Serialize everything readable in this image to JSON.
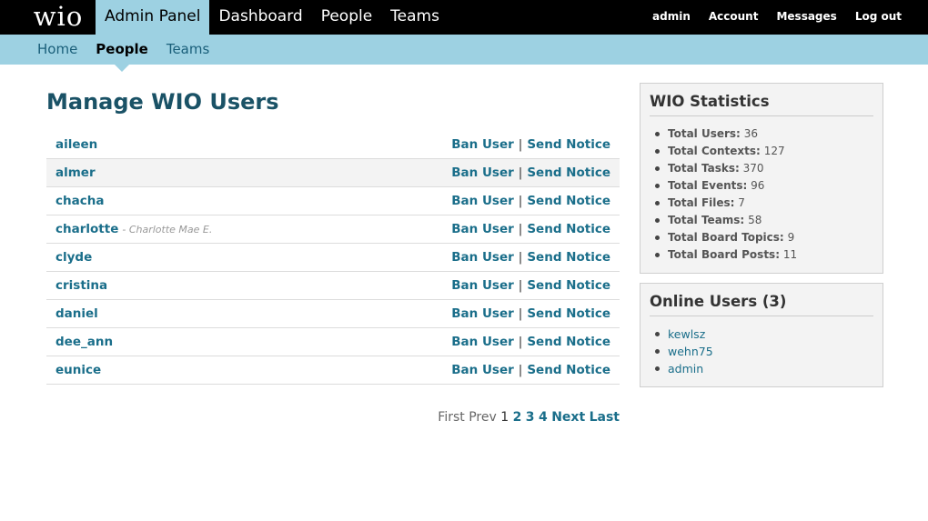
{
  "brand": {
    "logo": "wio"
  },
  "main_nav": [
    {
      "label": "Admin Panel",
      "active": true
    },
    {
      "label": "Dashboard",
      "active": false
    },
    {
      "label": "People",
      "active": false
    },
    {
      "label": "Teams",
      "active": false
    }
  ],
  "user_nav": [
    {
      "label": "admin"
    },
    {
      "label": "Account"
    },
    {
      "label": "Messages"
    },
    {
      "label": "Log out"
    }
  ],
  "sub_nav": [
    {
      "label": "Home",
      "active": false
    },
    {
      "label": "People",
      "active": true
    },
    {
      "label": "Teams",
      "active": false
    }
  ],
  "page": {
    "title": "Manage WIO Users"
  },
  "users": [
    {
      "username": "aileen",
      "real_name": ""
    },
    {
      "username": "almer",
      "real_name": ""
    },
    {
      "username": "chacha",
      "real_name": ""
    },
    {
      "username": "charlotte",
      "real_name": "- Charlotte Mae E."
    },
    {
      "username": "clyde",
      "real_name": ""
    },
    {
      "username": "cristina",
      "real_name": ""
    },
    {
      "username": "daniel",
      "real_name": ""
    },
    {
      "username": "dee_ann",
      "real_name": ""
    },
    {
      "username": "eunice",
      "real_name": ""
    }
  ],
  "row_actions": {
    "ban": "Ban User",
    "separator": "|",
    "notice": "Send Notice"
  },
  "pager": {
    "first": "First",
    "prev": "Prev",
    "current": "1",
    "pages": [
      "2",
      "3",
      "4"
    ],
    "next": "Next",
    "last": "Last"
  },
  "stats": {
    "title": "WIO Statistics",
    "items": [
      {
        "label": "Total Users:",
        "value": "36"
      },
      {
        "label": "Total Contexts:",
        "value": "127"
      },
      {
        "label": "Total Tasks:",
        "value": "370"
      },
      {
        "label": "Total Events:",
        "value": "96"
      },
      {
        "label": "Total Files:",
        "value": "7"
      },
      {
        "label": "Total Teams:",
        "value": "58"
      },
      {
        "label": "Total Board Topics:",
        "value": "9"
      },
      {
        "label": "Total Board Posts:",
        "value": "11"
      }
    ]
  },
  "online": {
    "title": "Online Users (3)",
    "users": [
      "kewlsz",
      "wehn75",
      "admin"
    ]
  },
  "colors": {
    "topbar": "#000000",
    "subbar": "#9dd1e2",
    "link": "#1a6e8a",
    "title": "#1a5266"
  }
}
